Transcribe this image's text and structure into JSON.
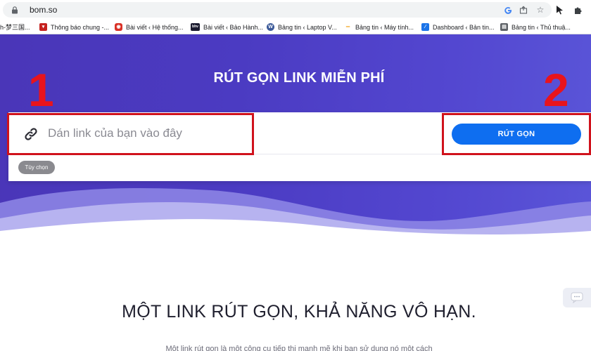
{
  "browser": {
    "url": "bom.so",
    "bookmarks": [
      {
        "label": "h-梦三国...",
        "color": "#9aa0a6"
      },
      {
        "label": "Thông báo chung -...",
        "color": "#c5221f"
      },
      {
        "label": "Bài viết ‹ Hệ thống...",
        "color": "#d93025"
      },
      {
        "label": "Bài viết ‹ Bảo Hành...",
        "color": "#1a1a2e"
      },
      {
        "label": "Bảng tin ‹ Laptop V...",
        "color": "#3c5a99"
      },
      {
        "label": "Bảng tin ‹ Máy tính...",
        "color": "#f29900"
      },
      {
        "label": "Dashboard ‹ Bản tin...",
        "color": "#1a73e8"
      },
      {
        "label": "Bảng tin ‹ Thủ thuậ...",
        "color": "#5f6368"
      }
    ],
    "icons": [
      "lock-icon",
      "google-icon",
      "share-icon",
      "bookmark-star-icon",
      "cursor-extension-icon",
      "puzzle-extension-icon"
    ]
  },
  "hero": {
    "title": "RÚT GỌN LINK MIỄN PHÍ",
    "annotation_left": "1",
    "annotation_right": "2",
    "gradient_start": "#4a36b8",
    "gradient_end": "#5a55d8",
    "annotation_color": "#e8141c"
  },
  "form": {
    "input_placeholder": "Dán link của bạn vào đây",
    "input_value": "",
    "shorten_label": "RÚT GỌN",
    "options_label": "Tùy chọn",
    "button_color": "#0e6ef0"
  },
  "section": {
    "title": "MỘT LINK RÚT GỌN, KHẢ NĂNG VÔ HẠN.",
    "body": "Một link rút gọn là một công cụ tiếp thị mạnh mẽ khi bạn sử dụng nó một cách"
  }
}
